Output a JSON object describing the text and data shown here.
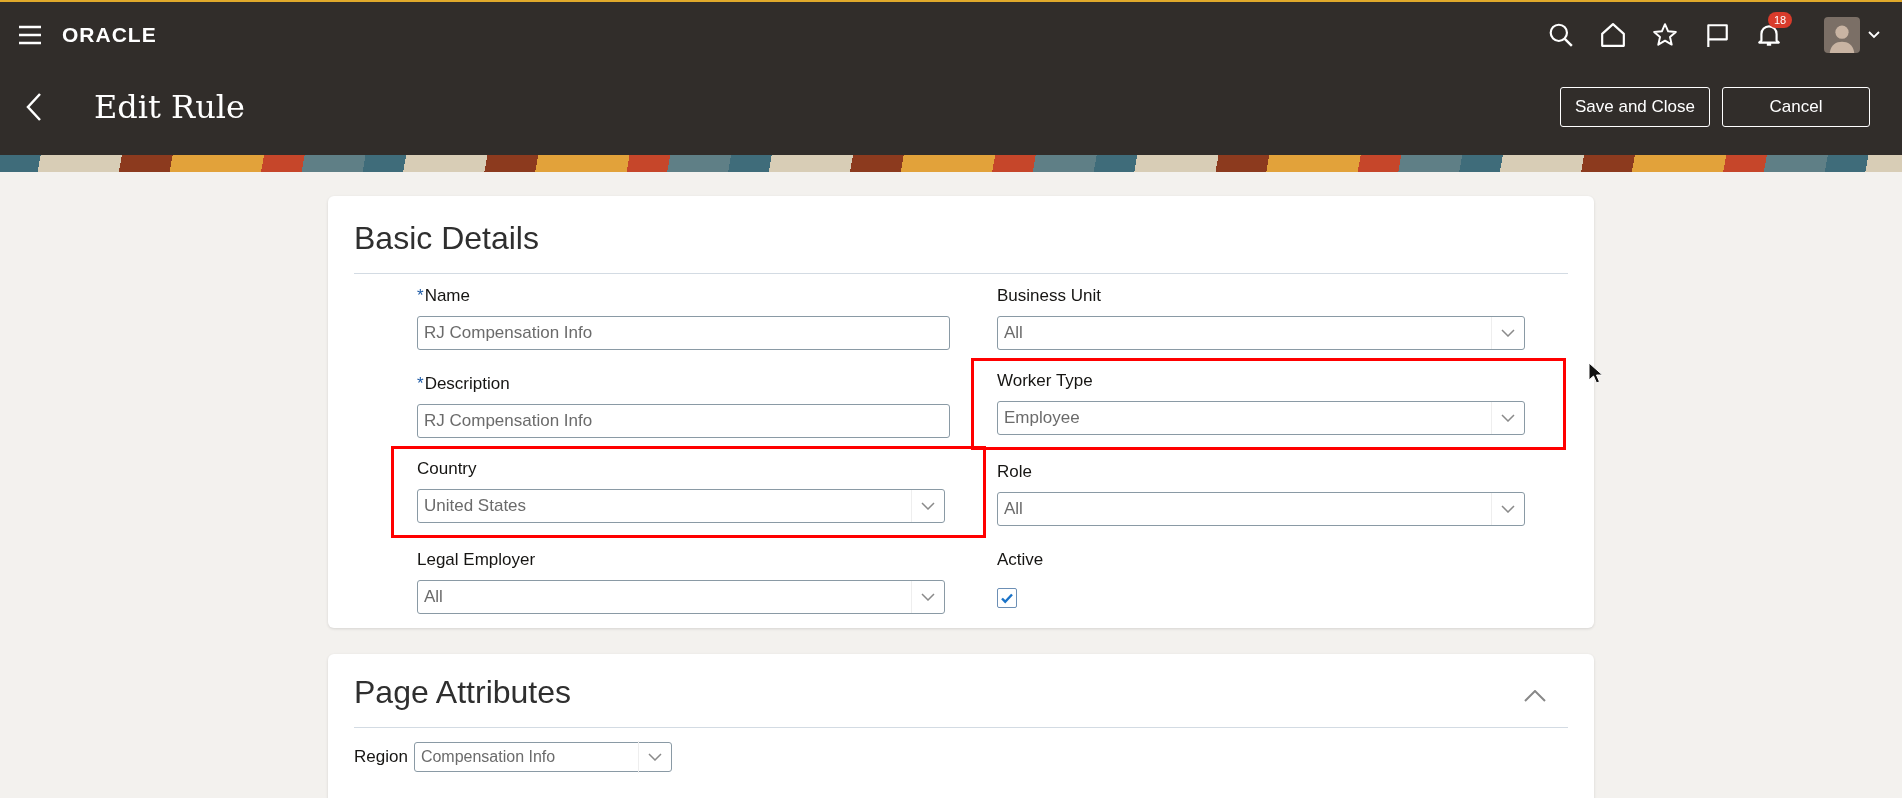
{
  "header": {
    "logo": "ORACLE",
    "notification_count": "18"
  },
  "page": {
    "title": "Edit Rule",
    "buttons": [
      {
        "label": "Save and Close"
      },
      {
        "label": "Cancel"
      }
    ]
  },
  "basic_details": {
    "title": "Basic Details",
    "columns": [
      [
        {
          "kind": "text",
          "label": "Name",
          "required_mark": "*",
          "value": "RJ Compensation Info",
          "highlighted": false
        },
        {
          "kind": "text",
          "label": "Description",
          "required_mark": "*",
          "value": "RJ Compensation Info",
          "highlighted": false
        },
        {
          "kind": "select",
          "label": "Country",
          "value": "United States",
          "highlighted": true
        },
        {
          "kind": "select",
          "label": "Legal Employer",
          "value": "All",
          "highlighted": false
        }
      ],
      [
        {
          "kind": "select",
          "label": "Business Unit",
          "value": "All",
          "highlighted": false
        },
        {
          "kind": "select",
          "label": "Worker Type",
          "value": "Employee",
          "highlighted": true
        },
        {
          "kind": "select",
          "label": "Role",
          "value": "All",
          "highlighted": false
        },
        {
          "kind": "checkbox",
          "label": "Active",
          "checked": true,
          "highlighted": false
        }
      ]
    ]
  },
  "page_attributes": {
    "title": "Page Attributes",
    "expanded": true,
    "region": {
      "label": "Region",
      "value": "Compensation Info"
    }
  }
}
